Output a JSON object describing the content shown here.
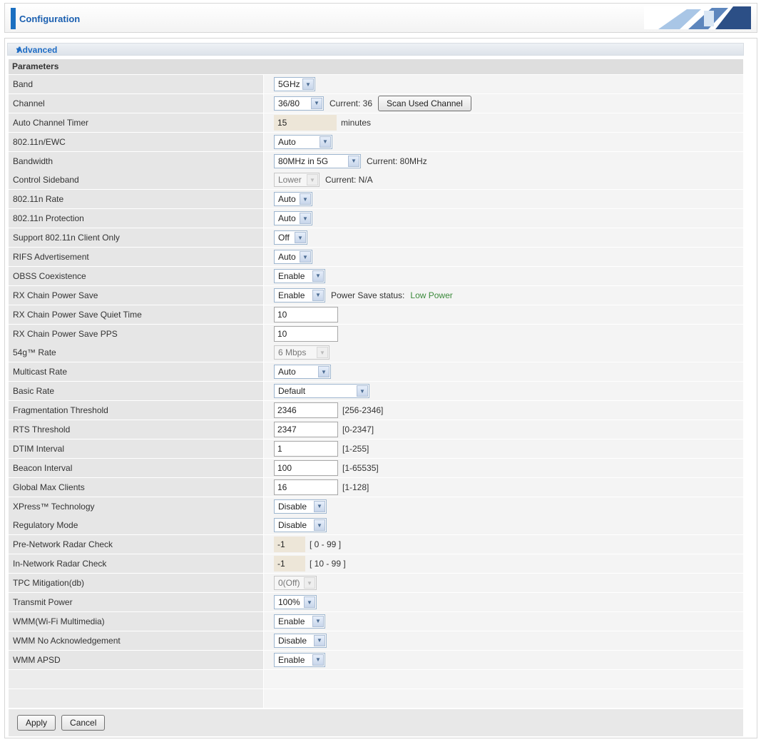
{
  "header": {
    "title": "Configuration"
  },
  "section": {
    "title": "Advanced"
  },
  "params": {
    "title": "Parameters"
  },
  "rows": {
    "band": {
      "label": "Band",
      "value": "5GHz"
    },
    "channel": {
      "label": "Channel",
      "value": "36/80",
      "current": "Current: 36",
      "scan_button": "Scan Used Channel"
    },
    "auto_channel_timer": {
      "label": "Auto Channel Timer",
      "value": "15",
      "unit": "minutes"
    },
    "ewc": {
      "label": "802.11n/EWC",
      "value": "Auto"
    },
    "bandwidth": {
      "label": "Bandwidth",
      "value": "80MHz in 5G",
      "current": "Current: 80MHz"
    },
    "control_sideband": {
      "label": "Control Sideband",
      "value": "Lower",
      "current": "Current: N/A"
    },
    "n_rate": {
      "label": "802.11n Rate",
      "value": "Auto"
    },
    "n_protection": {
      "label": "802.11n Protection",
      "value": "Auto"
    },
    "client_only": {
      "label": "Support 802.11n Client Only",
      "value": "Off"
    },
    "rifs": {
      "label": "RIFS Advertisement",
      "value": "Auto"
    },
    "obss": {
      "label": "OBSS Coexistence",
      "value": "Enable"
    },
    "rx_power_save": {
      "label": "RX Chain Power Save",
      "value": "Enable",
      "status_label": "Power Save status:",
      "status_value": "Low Power"
    },
    "rx_quiet_time": {
      "label": "RX Chain Power Save Quiet Time",
      "value": "10"
    },
    "rx_pps": {
      "label": "RX Chain Power Save PPS",
      "value": "10"
    },
    "g_rate": {
      "label": "54g™ Rate",
      "value": "6 Mbps"
    },
    "multicast_rate": {
      "label": "Multicast Rate",
      "value": "Auto"
    },
    "basic_rate": {
      "label": "Basic Rate",
      "value": "Default"
    },
    "frag_threshold": {
      "label": "Fragmentation Threshold",
      "value": "2346",
      "range": "[256-2346]"
    },
    "rts_threshold": {
      "label": "RTS Threshold",
      "value": "2347",
      "range": "[0-2347]"
    },
    "dtim": {
      "label": "DTIM Interval",
      "value": "1",
      "range": "[1-255]"
    },
    "beacon": {
      "label": "Beacon Interval",
      "value": "100",
      "range": "[1-65535]"
    },
    "max_clients": {
      "label": "Global Max Clients",
      "value": "16",
      "range": "[1-128]"
    },
    "xpress": {
      "label": "XPress™ Technology",
      "value": "Disable"
    },
    "regulatory": {
      "label": "Regulatory Mode",
      "value": "Disable"
    },
    "pre_radar": {
      "label": "Pre-Network Radar Check",
      "value": "-1",
      "range": "[ 0 - 99 ]"
    },
    "in_radar": {
      "label": "In-Network Radar Check",
      "value": "-1",
      "range": "[ 10 - 99 ]"
    },
    "tpc": {
      "label": "TPC Mitigation(db)",
      "value": "0(Off)"
    },
    "tx_power": {
      "label": "Transmit Power",
      "value": "100%"
    },
    "wmm": {
      "label": "WMM(Wi-Fi Multimedia)",
      "value": "Enable"
    },
    "wmm_noack": {
      "label": "WMM No Acknowledgement",
      "value": "Disable"
    },
    "wmm_apsd": {
      "label": "WMM APSD",
      "value": "Enable"
    }
  },
  "footer": {
    "apply": "Apply",
    "cancel": "Cancel"
  },
  "colors": {
    "accent": "#1b6fc0",
    "link": "#1e6cc4",
    "status_green": "#3b8a3b"
  }
}
